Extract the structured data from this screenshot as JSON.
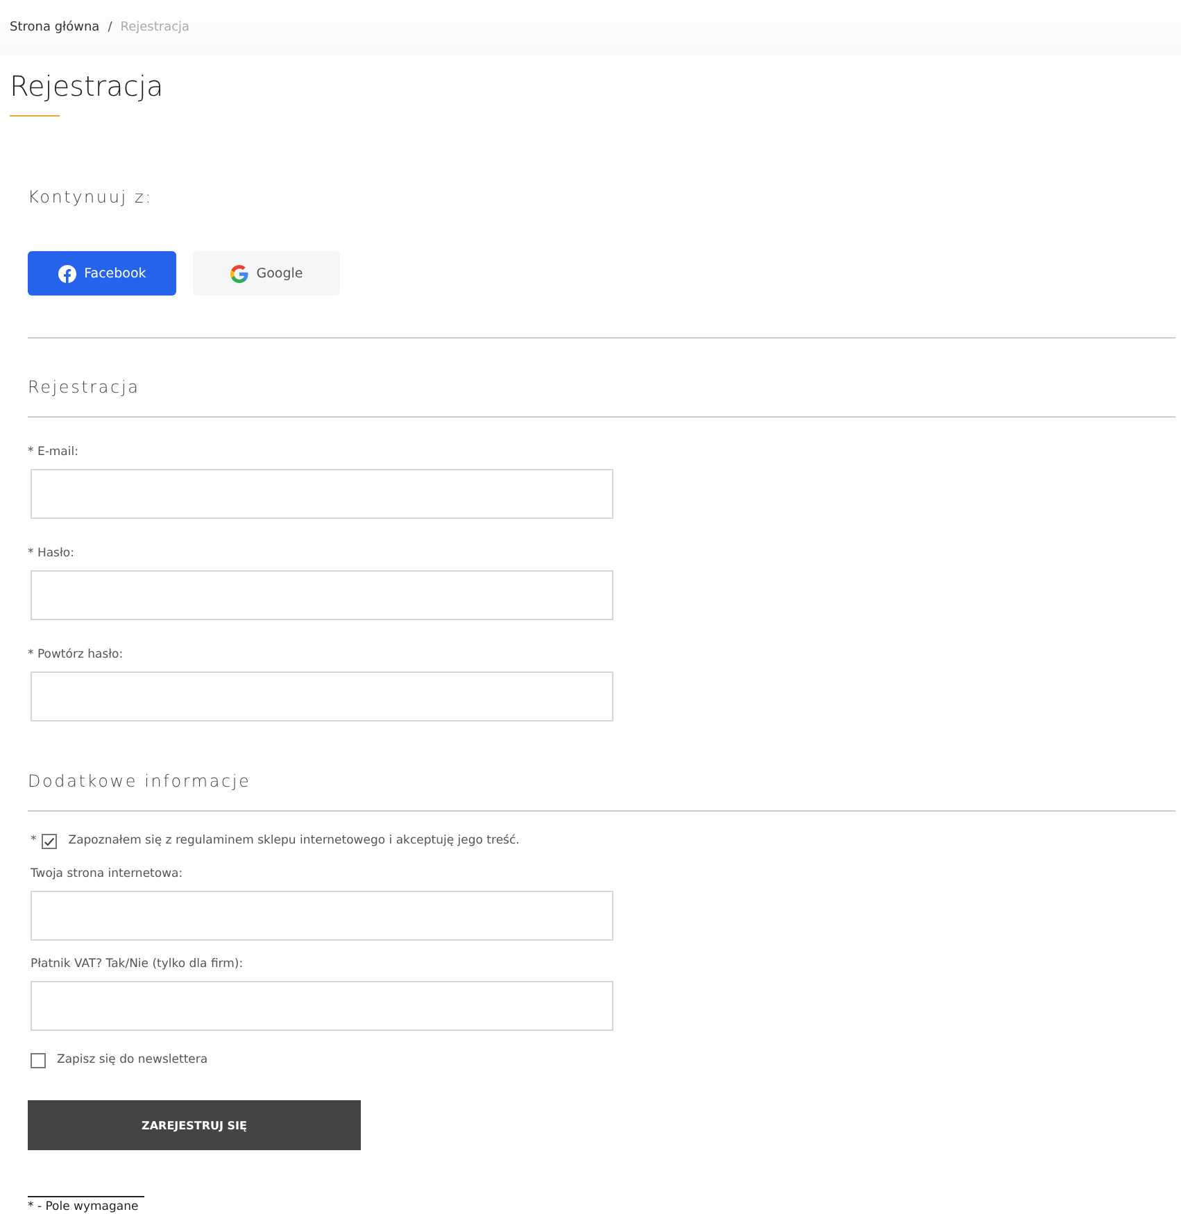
{
  "breadcrumb": [
    {
      "label": "Strona główna",
      "current": false
    },
    {
      "label": "Rejestracja",
      "current": true
    }
  ],
  "breadcrumb_separator": "/",
  "title": "Rejestracja",
  "social": {
    "heading": "Kontynuuj z:",
    "buttons": [
      {
        "kind": "facebook",
        "label": "Facebook"
      },
      {
        "kind": "google",
        "label": "Google"
      }
    ]
  },
  "registration": {
    "heading": "Rejestracja",
    "fields": [
      {
        "label": "* E-mail:"
      },
      {
        "label": "* Hasło:"
      },
      {
        "label": "* Powtórz hasło:"
      }
    ]
  },
  "additional": {
    "heading": "Dodatkowe informacje",
    "items": [
      {
        "kind": "checkbox",
        "required_mark": "*",
        "label": "Zapoznałem się z regulaminem sklepu internetowego i akceptuję jego treść.",
        "checked": true
      },
      {
        "kind": "field",
        "label": "Twoja strona internetowa:"
      },
      {
        "kind": "field",
        "label": "Płatnik VAT? Tak/Nie (tylko dla firm):"
      },
      {
        "kind": "checkbox",
        "label": "Zapisz się do newslettera",
        "checked": false
      }
    ]
  },
  "submit": "ZAREJESTRUJ SIĘ",
  "footnote": "* - Pole wymagane"
}
